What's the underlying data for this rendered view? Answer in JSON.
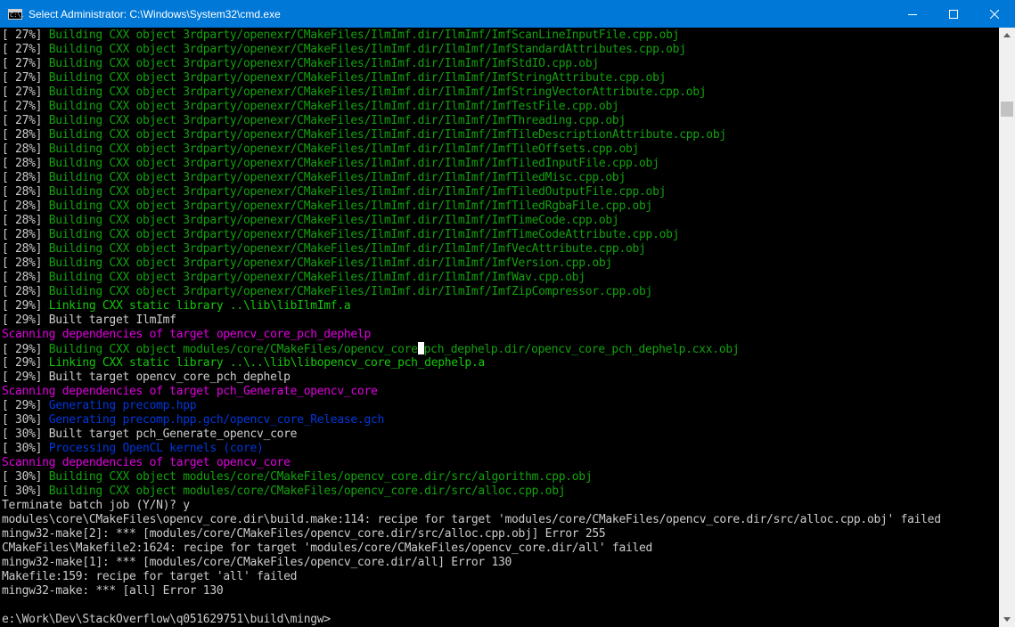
{
  "window": {
    "title": "Select Administrator: C:\\Windows\\System32\\cmd.exe",
    "icon_text": "C:\\."
  },
  "colors": {
    "titlebar": "#0078d7",
    "green": "#13a10e",
    "light_green": "#16c60c",
    "magenta": "#b11fbe",
    "blue": "#0037da",
    "gray": "#cccccc"
  },
  "lines": [
    {
      "p": "[ 27%] ",
      "t": "Building CXX object 3rdparty/openexr/CMakeFiles/IlmImf.dir/IlmImf/ImfScanLineInputFile.cpp.obj",
      "c": "g"
    },
    {
      "p": "[ 27%] ",
      "t": "Building CXX object 3rdparty/openexr/CMakeFiles/IlmImf.dir/IlmImf/ImfStandardAttributes.cpp.obj",
      "c": "g"
    },
    {
      "p": "[ 27%] ",
      "t": "Building CXX object 3rdparty/openexr/CMakeFiles/IlmImf.dir/IlmImf/ImfStdIO.cpp.obj",
      "c": "g"
    },
    {
      "p": "[ 27%] ",
      "t": "Building CXX object 3rdparty/openexr/CMakeFiles/IlmImf.dir/IlmImf/ImfStringAttribute.cpp.obj",
      "c": "g"
    },
    {
      "p": "[ 27%] ",
      "t": "Building CXX object 3rdparty/openexr/CMakeFiles/IlmImf.dir/IlmImf/ImfStringVectorAttribute.cpp.obj",
      "c": "g"
    },
    {
      "p": "[ 27%] ",
      "t": "Building CXX object 3rdparty/openexr/CMakeFiles/IlmImf.dir/IlmImf/ImfTestFile.cpp.obj",
      "c": "g"
    },
    {
      "p": "[ 27%] ",
      "t": "Building CXX object 3rdparty/openexr/CMakeFiles/IlmImf.dir/IlmImf/ImfThreading.cpp.obj",
      "c": "g"
    },
    {
      "p": "[ 28%] ",
      "t": "Building CXX object 3rdparty/openexr/CMakeFiles/IlmImf.dir/IlmImf/ImfTileDescriptionAttribute.cpp.obj",
      "c": "g"
    },
    {
      "p": "[ 28%] ",
      "t": "Building CXX object 3rdparty/openexr/CMakeFiles/IlmImf.dir/IlmImf/ImfTileOffsets.cpp.obj",
      "c": "g"
    },
    {
      "p": "[ 28%] ",
      "t": "Building CXX object 3rdparty/openexr/CMakeFiles/IlmImf.dir/IlmImf/ImfTiledInputFile.cpp.obj",
      "c": "g"
    },
    {
      "p": "[ 28%] ",
      "t": "Building CXX object 3rdparty/openexr/CMakeFiles/IlmImf.dir/IlmImf/ImfTiledMisc.cpp.obj",
      "c": "g"
    },
    {
      "p": "[ 28%] ",
      "t": "Building CXX object 3rdparty/openexr/CMakeFiles/IlmImf.dir/IlmImf/ImfTiledOutputFile.cpp.obj",
      "c": "g"
    },
    {
      "p": "[ 28%] ",
      "t": "Building CXX object 3rdparty/openexr/CMakeFiles/IlmImf.dir/IlmImf/ImfTiledRgbaFile.cpp.obj",
      "c": "g"
    },
    {
      "p": "[ 28%] ",
      "t": "Building CXX object 3rdparty/openexr/CMakeFiles/IlmImf.dir/IlmImf/ImfTimeCode.cpp.obj",
      "c": "g"
    },
    {
      "p": "[ 28%] ",
      "t": "Building CXX object 3rdparty/openexr/CMakeFiles/IlmImf.dir/IlmImf/ImfTimeCodeAttribute.cpp.obj",
      "c": "g"
    },
    {
      "p": "[ 28%] ",
      "t": "Building CXX object 3rdparty/openexr/CMakeFiles/IlmImf.dir/IlmImf/ImfVecAttribute.cpp.obj",
      "c": "g"
    },
    {
      "p": "[ 28%] ",
      "t": "Building CXX object 3rdparty/openexr/CMakeFiles/IlmImf.dir/IlmImf/ImfVersion.cpp.obj",
      "c": "g"
    },
    {
      "p": "[ 28%] ",
      "t": "Building CXX object 3rdparty/openexr/CMakeFiles/IlmImf.dir/IlmImf/ImfWav.cpp.obj",
      "c": "g"
    },
    {
      "p": "[ 28%] ",
      "t": "Building CXX object 3rdparty/openexr/CMakeFiles/IlmImf.dir/IlmImf/ImfZipCompressor.cpp.obj",
      "c": "g"
    },
    {
      "p": "[ 29%] ",
      "t": "Linking CXX static library ..\\lib\\libIlmImf.a",
      "c": "lg"
    },
    {
      "p": "[ 29%] ",
      "t": "Built target IlmImf",
      "c": "w"
    },
    {
      "p": "",
      "t": "Scanning dependencies of target opencv_core_pch_dephelp",
      "c": "m"
    },
    {
      "p": "[ 29%] ",
      "t": "Building CXX object modules/core/CMakeFiles/opencv_core",
      "t2": "pch_dephelp.dir/opencv_core_pch_dephelp.cxx.obj",
      "c": "g",
      "cursor": true
    },
    {
      "p": "[ 29%] ",
      "t": "Linking CXX static library ..\\..\\lib\\libopencv_core_pch_dephelp.a",
      "c": "lg"
    },
    {
      "p": "[ 29%] ",
      "t": "Built target opencv_core_pch_dephelp",
      "c": "w"
    },
    {
      "p": "",
      "t": "Scanning dependencies of target pch_Generate_opencv_core",
      "c": "m"
    },
    {
      "p": "[ 29%] ",
      "t": "Generating precomp.hpp",
      "c": "b"
    },
    {
      "p": "[ 30%] ",
      "t": "Generating precomp.hpp.gch/opencv_core_Release.gch",
      "c": "b"
    },
    {
      "p": "[ 30%] ",
      "t": "Built target pch_Generate_opencv_core",
      "c": "w"
    },
    {
      "p": "[ 30%] ",
      "t": "Processing OpenCL kernels (core)",
      "c": "b"
    },
    {
      "p": "",
      "t": "Scanning dependencies of target opencv_core",
      "c": "m"
    },
    {
      "p": "[ 30%] ",
      "t": "Building CXX object modules/core/CMakeFiles/opencv_core.dir/src/algorithm.cpp.obj",
      "c": "g"
    },
    {
      "p": "[ 30%] ",
      "t": "Building CXX object modules/core/CMakeFiles/opencv_core.dir/src/alloc.cpp.obj",
      "c": "g"
    },
    {
      "p": "",
      "t": "Terminate batch job (Y/N)? y",
      "c": "w"
    },
    {
      "p": "",
      "t": "modules\\core\\CMakeFiles\\opencv_core.dir\\build.make:114: recipe for target 'modules/core/CMakeFiles/opencv_core.dir/src/alloc.cpp.obj' failed",
      "c": "w"
    },
    {
      "p": "",
      "t": "mingw32-make[2]: *** [modules/core/CMakeFiles/opencv_core.dir/src/alloc.cpp.obj] Error 255",
      "c": "w"
    },
    {
      "p": "",
      "t": "CMakeFiles\\Makefile2:1624: recipe for target 'modules/core/CMakeFiles/opencv_core.dir/all' failed",
      "c": "w"
    },
    {
      "p": "",
      "t": "mingw32-make[1]: *** [modules/core/CMakeFiles/opencv_core.dir/all] Error 130",
      "c": "w"
    },
    {
      "p": "",
      "t": "Makefile:159: recipe for target 'all' failed",
      "c": "w"
    },
    {
      "p": "",
      "t": "mingw32-make: *** [all] Error 130",
      "c": "w"
    },
    {
      "p": "",
      "t": "",
      "c": "w"
    },
    {
      "p": "",
      "t": "e:\\Work\\Dev\\StackOverflow\\q051629751\\build\\mingw>",
      "c": "w"
    }
  ]
}
